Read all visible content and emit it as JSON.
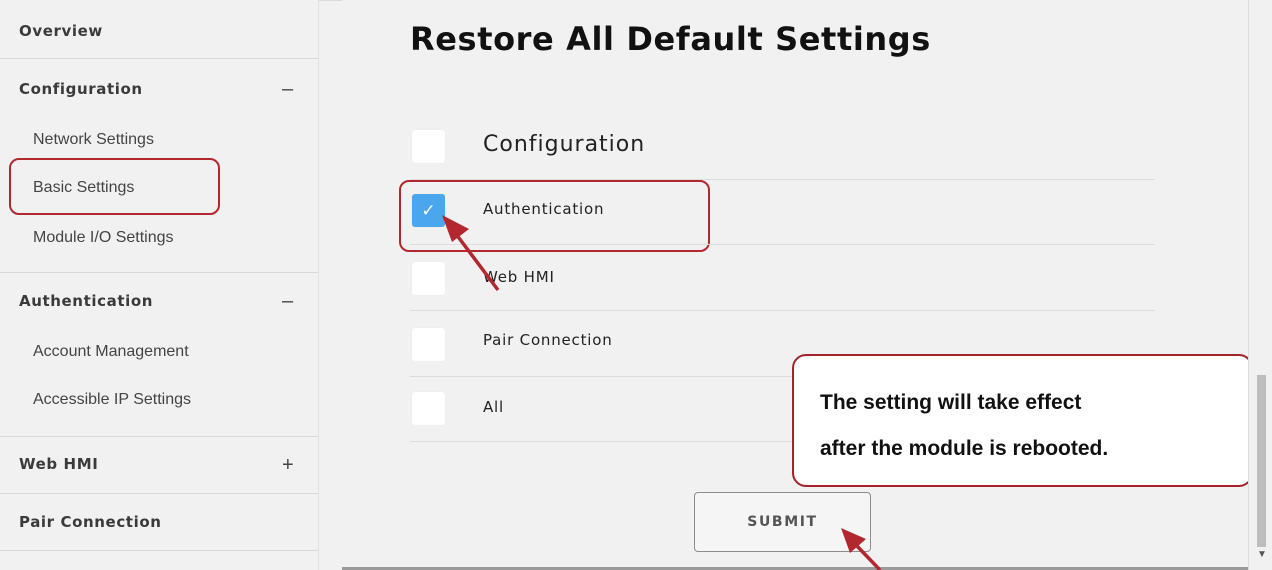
{
  "sidebar": {
    "overview": "Overview",
    "configuration": {
      "label": "Configuration",
      "toggle": "–"
    },
    "config_items": [
      "Network Settings",
      "Basic Settings",
      "Module I/O Settings"
    ],
    "authentication": {
      "label": "Authentication",
      "toggle": "–"
    },
    "auth_items": [
      "Account Management",
      "Accessible IP Settings"
    ],
    "web_hmi": {
      "label": "Web HMI",
      "toggle": "+"
    },
    "pair_connection": {
      "label": "Pair Connection"
    }
  },
  "main": {
    "title": "Restore All Default Settings",
    "options": [
      {
        "label": "Configuration",
        "checked": false
      },
      {
        "label": "Authentication",
        "checked": true
      },
      {
        "label": "Web HMI",
        "checked": false
      },
      {
        "label": "Pair Connection",
        "checked": false
      },
      {
        "label": "All",
        "checked": false
      }
    ],
    "check_glyph": "✓",
    "submit_label": "SUBMIT"
  },
  "callout": {
    "line1": "The setting will take effect",
    "line2": "after the module is rebooted."
  },
  "colors": {
    "highlight": "#b3272e",
    "checkbox_checked": "#4aa7ee"
  },
  "icons": {
    "collapse": "minus-icon",
    "expand": "plus-icon",
    "check": "check-icon",
    "scroll_down": "scroll-down-arrow-icon"
  }
}
